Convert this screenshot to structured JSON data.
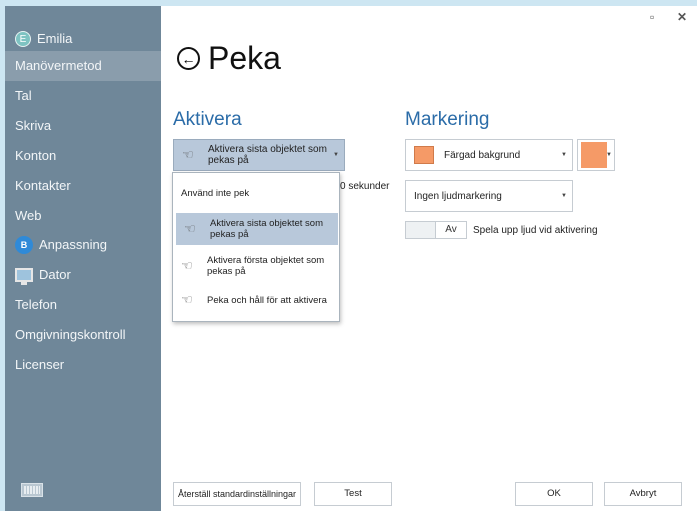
{
  "sidebar": {
    "user": {
      "initial": "E",
      "name": "Emilia"
    },
    "items": [
      {
        "label": "Manövermetod",
        "selected": true
      },
      {
        "label": "Tal"
      },
      {
        "label": "Skriva"
      },
      {
        "label": "Konton"
      },
      {
        "label": "Kontakter"
      },
      {
        "label": "Web"
      },
      {
        "label": "Anpassning",
        "icon": "anpassning-icon"
      },
      {
        "label": "Dator",
        "icon": "monitor-icon"
      },
      {
        "label": "Telefon"
      },
      {
        "label": "Omgivningskontroll"
      },
      {
        "label": "Licenser"
      }
    ],
    "keyboard_icon": "keyboard-icon"
  },
  "window": {
    "minimize": "▫",
    "close": "✕"
  },
  "page": {
    "title": "Peka",
    "back_icon": "back-arrow-icon",
    "back_glyph": "←"
  },
  "aktivera": {
    "heading": "Aktivera",
    "selected_value": "Aktivera sista objektet som pekas på",
    "seconds_text": "0 sekunder",
    "options": [
      {
        "label": "Använd inte pek",
        "icon": ""
      },
      {
        "label": "Aktivera sista objektet som pekas på",
        "icon": "point-hand-icon",
        "selected": true
      },
      {
        "label": "Aktivera första objektet som pekas på",
        "icon": "point-hand-icon"
      },
      {
        "label": "Peka och håll för att aktivera",
        "icon": "point-hold-hand-icon"
      }
    ]
  },
  "markering": {
    "heading": "Markering",
    "color_mode": "Färgad bakgrund",
    "color": "#f59a67",
    "sound": "Ingen ljudmarkering",
    "toggle_label": "Av",
    "toggle_caption": "Spela upp ljud vid aktivering"
  },
  "footer": {
    "reset": "Återställ standardinställningar",
    "test": "Test",
    "ok": "OK",
    "cancel": "Avbryt"
  }
}
